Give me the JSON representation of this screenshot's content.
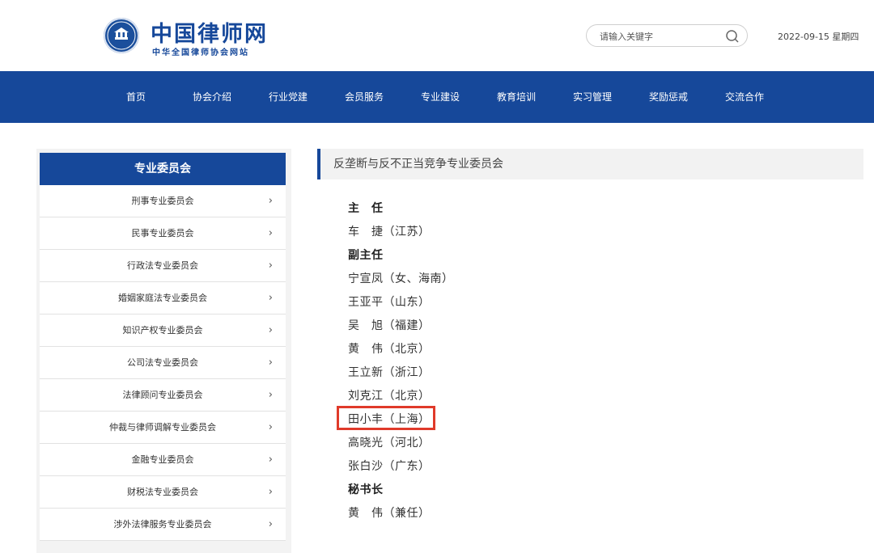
{
  "header": {
    "logo_title": "中国律师网",
    "logo_subtitle": "中华全国律师协会网站",
    "search_placeholder": "请输入关键字",
    "date": "2022-09-15 星期四"
  },
  "nav": {
    "items": [
      {
        "label": "首页"
      },
      {
        "label": "协会介绍"
      },
      {
        "label": "行业党建"
      },
      {
        "label": "会员服务"
      },
      {
        "label": "专业建设"
      },
      {
        "label": "教育培训"
      },
      {
        "label": "实习管理"
      },
      {
        "label": "奖励惩戒"
      },
      {
        "label": "交流合作"
      }
    ]
  },
  "sidebar": {
    "title": "专业委员会",
    "items": [
      {
        "label": "刑事专业委员会"
      },
      {
        "label": "民事专业委员会"
      },
      {
        "label": "行政法专业委员会"
      },
      {
        "label": "婚姻家庭法专业委员会"
      },
      {
        "label": "知识产权专业委员会"
      },
      {
        "label": "公司法专业委员会"
      },
      {
        "label": "法律顾问专业委员会"
      },
      {
        "label": "仲裁与律师调解专业委员会"
      },
      {
        "label": "金融专业委员会"
      },
      {
        "label": "财税法专业委员会"
      },
      {
        "label": "涉外法律服务专业委员会"
      }
    ],
    "chevron": "›"
  },
  "content": {
    "title": "反垄断与反不正当竞争专业委员会",
    "rows": [
      {
        "text": "主　任",
        "role": true
      },
      {
        "text": "车　捷（江苏）"
      },
      {
        "text": "副主任",
        "role": true
      },
      {
        "text": "宁宣凤（女、海南）"
      },
      {
        "text": "王亚平（山东）"
      },
      {
        "text": "吴　旭（福建）"
      },
      {
        "text": "黄　伟（北京）"
      },
      {
        "text": "王立新（浙江）"
      },
      {
        "text": "刘克江（北京）"
      },
      {
        "text": "田小丰（上海）"
      },
      {
        "text": "高晓光（河北）"
      },
      {
        "text": "张白沙（广东）"
      },
      {
        "text": "秘书长",
        "role": true
      },
      {
        "text": "黄　伟（兼任）"
      }
    ]
  },
  "colors": {
    "brand": "#16489a",
    "highlight": "#e03a2a"
  }
}
